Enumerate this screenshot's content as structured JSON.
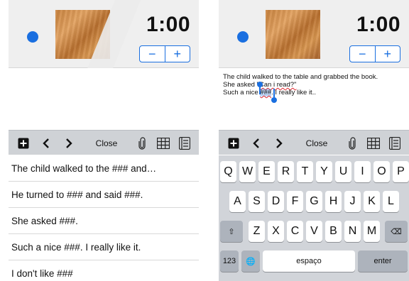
{
  "left_screen": {
    "timer": "1:00",
    "stepper": {
      "minus": "−",
      "plus": "+"
    },
    "toolbar": {
      "close_label": "Close"
    },
    "sentences": [
      "The child walked to the ### and…",
      "He turned to ### and said ###.",
      "She asked ###.",
      "Such a nice ###. I really like it.",
      "I don't like ###"
    ]
  },
  "right_screen": {
    "timer": "1:00",
    "stepper": {
      "minus": "−",
      "plus": "+"
    },
    "editor": {
      "line1": "The child walked to the table and grabbed the book.",
      "line2_a": "She asked \"",
      "line2_b": "Can i read?\"",
      "line3_a": "Such a nice ",
      "line3_sel": "###",
      "line3_b": ". I really like it.."
    },
    "toolbar": {
      "close_label": "Close"
    },
    "keyboard": {
      "row1": [
        "Q",
        "W",
        "E",
        "R",
        "T",
        "Y",
        "U",
        "I",
        "O",
        "P"
      ],
      "row2": [
        "A",
        "S",
        "D",
        "F",
        "G",
        "H",
        "J",
        "K",
        "L"
      ],
      "row3": [
        "Z",
        "X",
        "C",
        "V",
        "B",
        "N",
        "M"
      ],
      "shift": "⇧",
      "backspace": "⌫",
      "numbers": "123",
      "globe": "🌐",
      "space": "espaço",
      "enter": "enter"
    }
  },
  "colors": {
    "accent": "#1a6fe0",
    "toolbar": "#cfd2d6",
    "topbar": "#efefef",
    "keyboard": "#d1d4d9"
  },
  "icons": [
    "record-dot-icon",
    "add-icon",
    "chevron-left-icon",
    "chevron-right-icon",
    "paperclip-icon",
    "grid-icon",
    "list-icon"
  ]
}
